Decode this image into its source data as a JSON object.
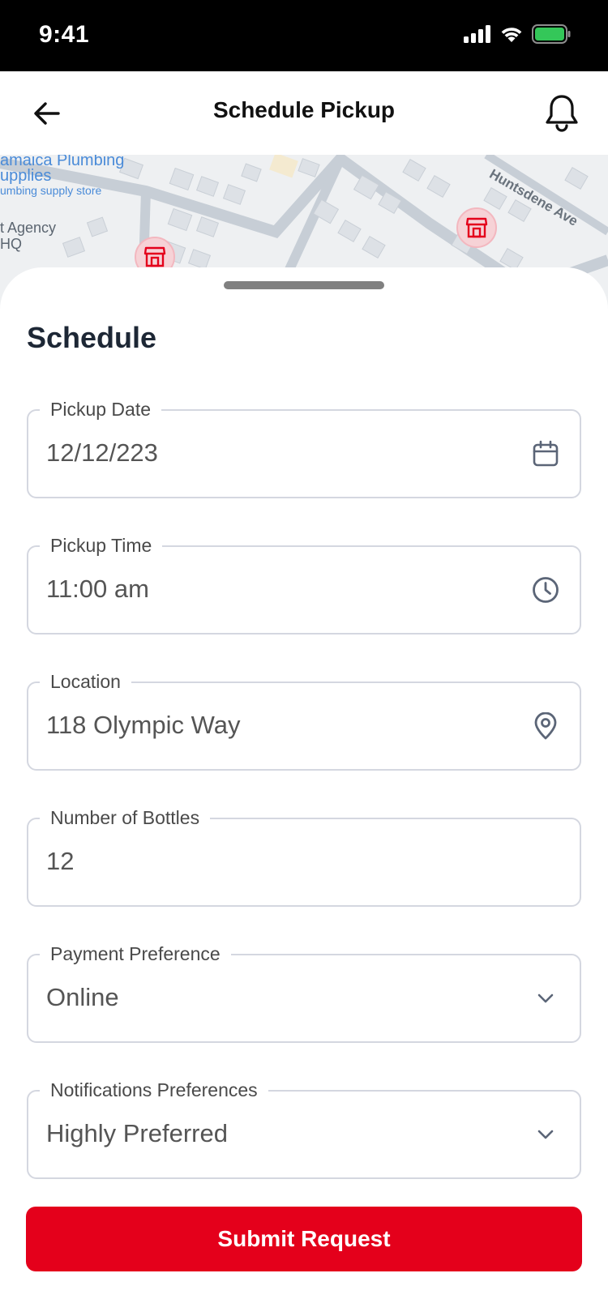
{
  "status_bar": {
    "time": "9:41",
    "icons": [
      "signal-icon",
      "wifi-icon",
      "battery-icon"
    ],
    "battery_color": "#34c759"
  },
  "header": {
    "title": "Schedule Pickup",
    "back_icon": "arrow-left-icon",
    "bell_icon": "bell-icon"
  },
  "map": {
    "labels": [
      "amaica Plumbing",
      "upplies",
      "umbing supply store",
      "t Agency",
      "HQ"
    ],
    "road": "Huntsdene Ave",
    "pin_icon": "store-icon"
  },
  "sheet": {
    "title": "Schedule",
    "fields": [
      {
        "label": "Pickup Date",
        "value": "12/12/223",
        "icon": "calendar-icon"
      },
      {
        "label": "Pickup Time",
        "value": "11:00 am",
        "icon": "clock-icon"
      },
      {
        "label": "Location",
        "value": "118 Olympic Way",
        "icon": "location-pin-icon"
      },
      {
        "label": "Number of Bottles",
        "value": "12",
        "icon": ""
      },
      {
        "label": "Payment Preference",
        "value": "Online",
        "icon": "chevron-down-icon"
      },
      {
        "label": "Notifications Preferences",
        "value": "Highly Preferred",
        "icon": "chevron-down-icon"
      }
    ],
    "submit_label": "Submit Request"
  },
  "colors": {
    "accent": "#e4001b",
    "border": "#d4d7e0",
    "title": "#1d2735",
    "pin_bg": "#f6d2d6"
  }
}
